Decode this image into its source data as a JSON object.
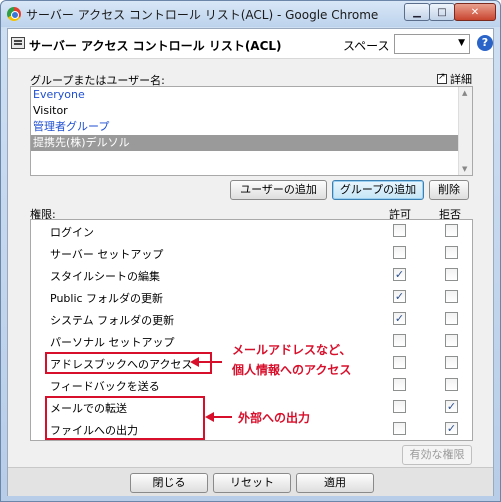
{
  "window": {
    "title": "サーバー アクセス コントロール リスト(ACL) - Google Chrome",
    "controls": {
      "minimize": "▁",
      "maximize": "□",
      "close": "✕"
    }
  },
  "header": {
    "title": "サーバー アクセス コントロール リスト(ACL)",
    "space_label": "スペース",
    "space_value": "",
    "help": "?"
  },
  "group": {
    "label": "グループまたはユーザー名:",
    "detail_link": "詳細",
    "items": [
      {
        "label": "Everyone",
        "style": "blue"
      },
      {
        "label": "Visitor",
        "style": "normal"
      },
      {
        "label": "管理者グループ",
        "style": "blue"
      },
      {
        "label": "提携先(株)デルソル",
        "style": "selected"
      }
    ],
    "buttons": {
      "add_user": "ユーザーの追加",
      "add_group": "グループの追加",
      "delete": "削除"
    }
  },
  "permissions": {
    "label": "権限:",
    "allow_header": "許可",
    "deny_header": "拒否",
    "rows": [
      {
        "name": "ログイン",
        "allow": false,
        "deny": false
      },
      {
        "name": "サーバー セットアップ",
        "allow": false,
        "deny": false
      },
      {
        "name": "スタイルシートの編集",
        "allow": true,
        "deny": false
      },
      {
        "name": "Public フォルダの更新",
        "allow": true,
        "deny": false
      },
      {
        "name": "システム フォルダの更新",
        "allow": true,
        "deny": false
      },
      {
        "name": "パーソナル セットアップ",
        "allow": false,
        "deny": false
      },
      {
        "name": "アドレスブックへのアクセス",
        "allow": false,
        "deny": false
      },
      {
        "name": "フィードバックを送る",
        "allow": false,
        "deny": false
      },
      {
        "name": "メールでの転送",
        "allow": false,
        "deny": true
      },
      {
        "name": "ファイルへの出力",
        "allow": false,
        "deny": true
      }
    ],
    "effective_button": "有効な権限"
  },
  "annotations": {
    "address_line1": "メールアドレスなど、",
    "address_line2": "個人情報へのアクセス",
    "export": "外部への出力"
  },
  "footer": {
    "close": "閉じる",
    "reset": "リセット",
    "apply": "適用"
  },
  "check_glyph": "✓",
  "colors": {
    "annotation_red": "#d80f2b",
    "link_blue": "#1f4fd0"
  }
}
